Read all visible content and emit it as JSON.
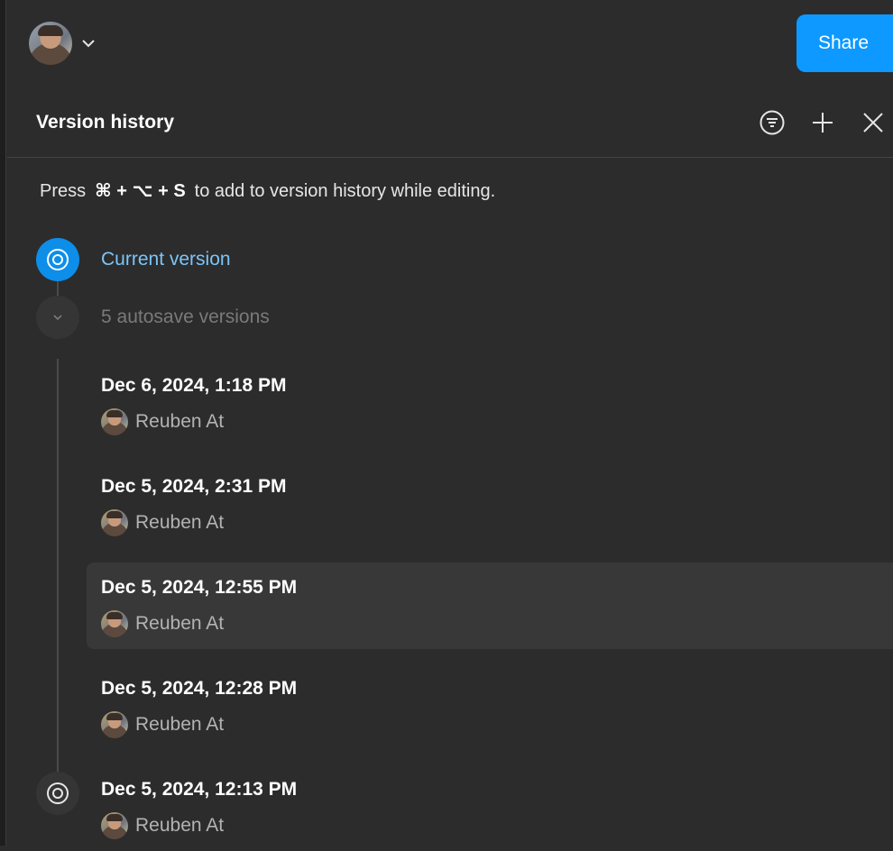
{
  "topbar": {
    "share_label": "Share",
    "accent": "#0d99ff"
  },
  "header": {
    "title": "Version history",
    "icons": [
      "filter-icon",
      "plus-icon",
      "close-icon"
    ]
  },
  "hint": {
    "prefix": "Press",
    "shortcut": "⌘ + ⌥ + S",
    "suffix": "to add to version history while editing."
  },
  "current": {
    "label": "Current version",
    "color": "#7cc4fa"
  },
  "autosave": {
    "label": "5 autosave versions"
  },
  "versions": [
    {
      "date": "Dec 6, 2024, 1:18 PM",
      "author": "Reuben At",
      "selected": false
    },
    {
      "date": "Dec 5, 2024, 2:31 PM",
      "author": "Reuben At",
      "selected": false
    },
    {
      "date": "Dec 5, 2024, 12:55 PM",
      "author": "Reuben At",
      "selected": true
    },
    {
      "date": "Dec 5, 2024, 12:28 PM",
      "author": "Reuben At",
      "selected": false
    },
    {
      "date": "Dec 5, 2024, 12:13 PM",
      "author": "Reuben At",
      "selected": false
    }
  ]
}
